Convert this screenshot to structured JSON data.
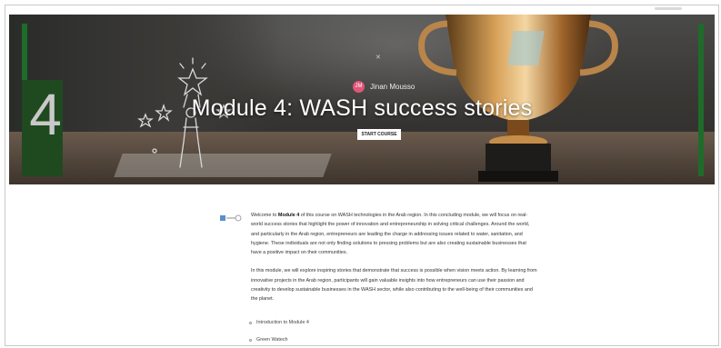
{
  "hero": {
    "module_number": "4",
    "author": {
      "initials": "JM",
      "name": "Jinan Mousso"
    },
    "title": "Module 4: WASH success stories",
    "start_button": "START COURSE"
  },
  "intro": {
    "p1_a": "Welcome to ",
    "p1_bold": "Module 4",
    "p1_b": " of this course on WASH technologies in the Arab region. In this concluding module, we will focus on real-world success stories that highlight the power of innovation and entrepreneurship in solving critical challenges. Around the world, and particularly in the Arab region, entrepreneurs are leading the charge in addressing issues related to water, sanitation, and hygiene. These individuals are not only finding solutions to pressing problems but are also creating sustainable businesses that have a positive impact on their communities.",
    "p2": "In this module, we will explore inspiring stories that demonstrate that success is possible when vision meets action. By learning from innovative projects in the Arab region, participants will gain valuable insights into how entrepreneurs can use their passion and creativity to develop sustainable businesses in the WASH sector, while also contributing to the well-being of their communities and the planet."
  },
  "lessons": [
    {
      "label": "Introduction to Module 4"
    },
    {
      "label": "Green Watech"
    }
  ],
  "colors": {
    "accent_green": "#1f6b2a",
    "avatar_pink": "#e2567a"
  }
}
